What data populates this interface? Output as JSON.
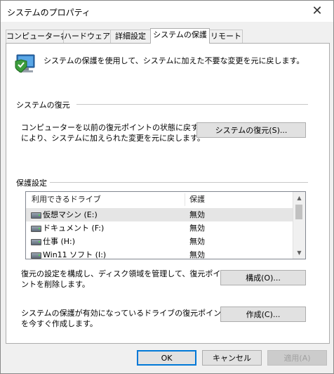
{
  "window": {
    "title": "システムのプロパティ",
    "close_glyph": "✕"
  },
  "tabs": [
    {
      "label": "コンピューター名"
    },
    {
      "label": "ハードウェア"
    },
    {
      "label": "詳細設定"
    },
    {
      "label": "システムの保護"
    },
    {
      "label": "リモート"
    }
  ],
  "intro": {
    "text": "システムの保護を使用して、システムに加えた不要な変更を元に戻します。",
    "icon": "computer-shield-icon"
  },
  "restore": {
    "heading": "システムの復元",
    "line1": "コンピューターを以前の復元ポイントの状態に戻すこと",
    "line2": "により、システムに加えられた変更を元に戻します。",
    "button_label": "システムの復元(S)..."
  },
  "protection": {
    "heading": "保護設定",
    "columns": [
      "利用できるドライブ",
      "保護"
    ],
    "drives": [
      {
        "name": "仮想マシン (E:)",
        "status": "無効"
      },
      {
        "name": "ドキュメント (F:)",
        "status": "無効"
      },
      {
        "name": "仕事 (H:)",
        "status": "無効"
      },
      {
        "name": "Win11 ソフト (I:)",
        "status": "無効"
      }
    ]
  },
  "configure": {
    "line1": "復元の設定を構成し、ディスク領域を管理して、復元ポイ",
    "line2": "ントを削除します。",
    "button_label": "構成(O)..."
  },
  "create": {
    "line1": "システムの保護が有効になっているドライブの復元ポイント",
    "line2": "を今すぐ作成します。",
    "button_label": "作成(C)..."
  },
  "footer": {
    "ok": "OK",
    "cancel": "キャンセル",
    "apply": "適用(A)"
  },
  "colors": {
    "accent": "#0078d7",
    "selected_row": "#e5e5e5"
  }
}
